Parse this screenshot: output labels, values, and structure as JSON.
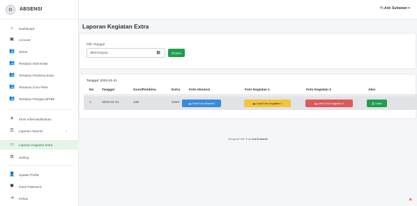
{
  "app": {
    "name": "ABSENSI",
    "logo_icon": "school-emblem-icon"
  },
  "user": {
    "greeting": "Hi,",
    "name": "Ade Suttawan",
    "caret": "▾"
  },
  "sidebar": {
    "items": [
      {
        "label": "Dashboard",
        "icon": "⌂"
      },
      {
        "label": "Account",
        "icon": "▣"
      },
      {
        "label": "Siswa",
        "icon": "👥"
      },
      {
        "label": "Tentukan Wali Kelas",
        "icon": "👥"
      },
      {
        "label": "Tentukan Pembina Extra",
        "icon": "👥"
      },
      {
        "label": "Tentukan Guru Piket",
        "icon": "👥"
      },
      {
        "label": "Tentukan Petugas BP/BK",
        "icon": "👥"
      },
      {
        "label": "Kirim Informasi/Edaran",
        "icon": "✈"
      },
      {
        "label": "Laporan Absensi",
        "icon": "☰",
        "chevron": "⌄"
      },
      {
        "label": "Laporan Kegiatan Extra",
        "icon": "▭",
        "active": true
      },
      {
        "label": "Setting",
        "icon": "⚙"
      },
      {
        "label": "Update Profile",
        "icon": "👤"
      },
      {
        "label": "Ganti Password",
        "icon": "⛊"
      },
      {
        "label": "Keluar",
        "icon": "⇥"
      }
    ]
  },
  "page": {
    "title": "Laporan Kegiatan Extra"
  },
  "filter": {
    "label": "Pilih Tanggal",
    "date_placeholder": "dd/mm/yyyy",
    "calendar_icon": "▦",
    "submit_label": "Proses"
  },
  "report": {
    "date_label": "Tanggal: 2023-01-21",
    "columns": [
      "No",
      "Tanggal",
      "Guru/Pembina",
      "Extra",
      "Foto Absensi",
      "Foto Kegiatan 1",
      "Foto Kegiatan 2",
      "Aksi"
    ],
    "rows": [
      {
        "no": "1",
        "tanggal": "2023-01-21",
        "guru": "139",
        "extra": "OSIS",
        "foto_absensi": "▬ Lihat Foto Absensi",
        "foto_kegiatan_1": "▬ Lihat Foto Kegiatan 1",
        "foto_kegiatan_2": "▬ Lihat Foto Kegiatan 2",
        "aksi": "⎙ Cetak"
      }
    ]
  },
  "footer": {
    "prefix": "Designed with",
    "heart": "♥",
    "by": "by",
    "author": "AdeSuttawan"
  },
  "colors": {
    "primary": "#1e9e50",
    "blue": "#3a8bdb",
    "yellow": "#f2c53d",
    "red": "#dc5a5a"
  }
}
